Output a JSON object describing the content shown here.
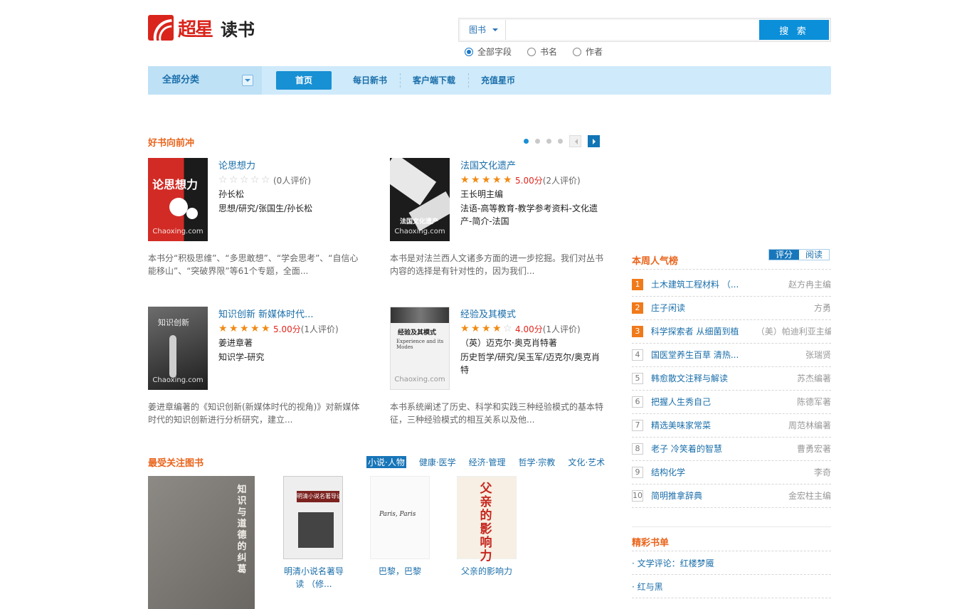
{
  "header": {
    "brand": "超星",
    "site_name": "读书",
    "search_type": "图书",
    "search_placeholder": "",
    "search_button": "搜 索",
    "radios": [
      "全部字段",
      "书名",
      "作者"
    ],
    "radio_selected": 0
  },
  "nav": {
    "category_label": "全部分类",
    "items": [
      "首页",
      "每日新书",
      "客户端下载",
      "充值星币"
    ],
    "active": 0
  },
  "featured": {
    "title": "好书向前冲",
    "pages": 4,
    "current_page": 1,
    "books": [
      {
        "title": "论思想力",
        "rating": 0,
        "score": "",
        "reviews": "(0人评价)",
        "author": "孙长松",
        "subjects": "思想/研究/张国生/孙长松",
        "desc": "本书分“积极思维”、“多思敢想”、“学会思考”、“自信心能移山”、“突破界限”等61个专题，全面...",
        "cover_text": "论思想力",
        "watermark": "Chaoxing.com"
      },
      {
        "title": "法国文化遗产",
        "rating": 5,
        "score": "5.00分",
        "reviews": "(2人评价)",
        "author": "王长明主编",
        "subjects": "法语-高等教育-教学参考资料-文化遗产-简介-法国",
        "desc": "本书是对法兰西人文诸多方面的进一步挖掘。我们对丛书内容的选择是有针对性的，因为我们...",
        "cover_text": "法国文化遗产",
        "watermark": "Chaoxing.com"
      },
      {
        "title": "知识创新 新媒体时代...",
        "rating": 5,
        "score": "5.00分",
        "reviews": "(1人评价)",
        "author": "姜进章著",
        "subjects": "知识学-研究",
        "desc": "姜进章编著的《知识创新(新媒体时代的视角)》对新媒体时代的知识创新进行分析研究，建立...",
        "cover_text": "知识创新",
        "watermark": "Chaoxing.com"
      },
      {
        "title": "经验及其模式",
        "rating": 4,
        "score": "4.00分",
        "reviews": "(1人评价)",
        "author": "（英）迈克尔·奥克肖特著",
        "subjects": "历史哲学/研究/吴玉军/迈克尔/奥克肖特",
        "desc": "本书系统阐述了历史、科学和实践三种经验模式的基本特征，三种经验模式的相互关系以及他...",
        "cover_text": "经验及其模式",
        "watermark": "Chaoxing.com"
      }
    ]
  },
  "favorites": {
    "title": "最受关注图书",
    "tabs": [
      "小说·人物",
      "健康·医学",
      "经济·管理",
      "哲学·宗教",
      "文化·艺术"
    ],
    "active_tab": 0,
    "books": [
      {
        "title": "",
        "cover_text": "知识与道德的纠葛"
      },
      {
        "title": "明清小说名著导读 （修...",
        "cover_text": "明清小说名著导读"
      },
      {
        "title": "巴黎，巴黎",
        "cover_text": "Paris, Paris"
      },
      {
        "title": "父亲的影响力",
        "cover_text": "父亲的影响力"
      }
    ]
  },
  "weekly_rank": {
    "title": "本周人气榜",
    "tabs": [
      "评分",
      "阅读"
    ],
    "active_tab": 0,
    "items": [
      {
        "n": "1",
        "title": "土木建筑工程材料 （...",
        "author": "赵方冉主编"
      },
      {
        "n": "2",
        "title": "庄子闲读",
        "author": "方勇"
      },
      {
        "n": "3",
        "title": "科学探索者 从细菌到植",
        "author": "（美）帕迪利亚主编"
      },
      {
        "n": "4",
        "title": "国医堂养生百草 清热...",
        "author": "张瑞贤"
      },
      {
        "n": "5",
        "title": "韩愈散文注释与解读",
        "author": "苏杰编著"
      },
      {
        "n": "6",
        "title": "把握人生秀自己",
        "author": "陈德军著"
      },
      {
        "n": "7",
        "title": "精选美味家常菜",
        "author": "周范林编著"
      },
      {
        "n": "8",
        "title": "老子 冷笑着的智慧",
        "author": "曹勇宏著"
      },
      {
        "n": "9",
        "title": "结构化学",
        "author": "李奇"
      },
      {
        "n": "10",
        "title": "简明推拿辞典",
        "author": "金宏柱主编"
      }
    ]
  },
  "booklists": {
    "title": "精彩书单",
    "items": [
      "· 文学评论：红楼梦魇",
      "· 红与黑"
    ]
  },
  "colors": {
    "accent": "#0b8fd9",
    "title_orange": "#e9641b",
    "link": "#1a6eaa",
    "star": "#f28a13"
  }
}
